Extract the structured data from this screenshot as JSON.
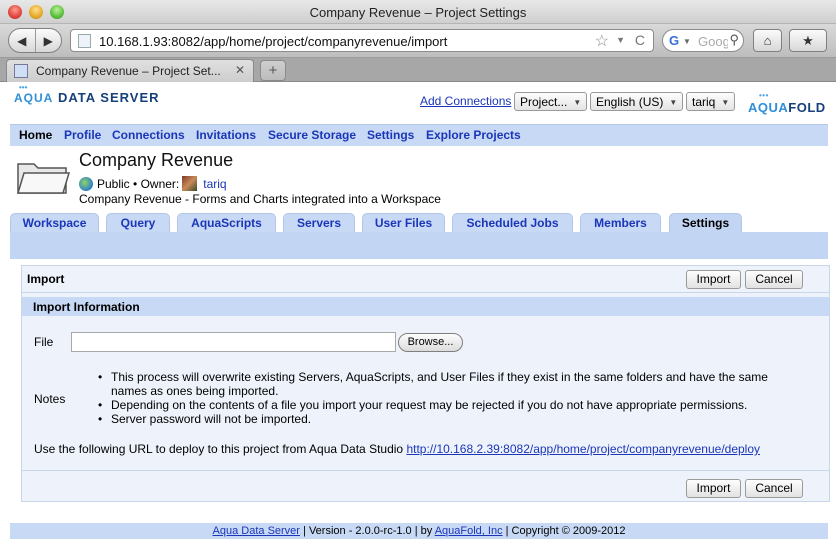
{
  "window": {
    "title": "Company Revenue – Project Settings"
  },
  "browser": {
    "url": "10.168.1.93:8082/app/home/project/companyrevenue/import",
    "search_placeholder": "Goog",
    "search_engine_icon": "G",
    "tab_title": "Company Revenue – Project Set...",
    "new_tab_symbol": "+",
    "back_icon": "◀",
    "forward_icon": "▶",
    "star_icon": "☆",
    "reload_icon": "C",
    "home_icon": "⌂",
    "addons_icon": "★"
  },
  "header": {
    "logo_left": {
      "prefix": "AQUA",
      "suffix": "DATA SERVER",
      "dots": "•••"
    },
    "add_connections": "Add Connections",
    "project_select": "Project...",
    "language_select": "English (US)",
    "user_select": "tariq",
    "logo_right": {
      "prefix": "AQUA",
      "suffix": "FOLD",
      "dots": "•••"
    }
  },
  "main_nav": [
    "Home",
    "Profile",
    "Connections",
    "Invitations",
    "Secure Storage",
    "Settings",
    "Explore Projects"
  ],
  "project": {
    "title": "Company Revenue",
    "visibility": "Public •",
    "owner_label": "Owner:",
    "owner": "tariq",
    "description": "Company Revenue - Forms and Charts integrated into a Workspace"
  },
  "project_tabs": [
    "Workspace",
    "Query",
    "AquaScripts",
    "Servers",
    "User Files",
    "Scheduled Jobs",
    "Members",
    "Settings"
  ],
  "import_panel": {
    "title": "Import",
    "import_button": "Import",
    "cancel_button": "Cancel",
    "section_title": "Import Information",
    "file_label": "File",
    "browse_button": "Browse...",
    "notes_label": "Notes",
    "notes": [
      "This process will overwrite existing Servers, AquaScripts, and User Files if they exist in the same folders and have the same names as ones being imported.",
      "Depending on the contents of a file you import your request may be rejected if you do not have appropriate permissions.",
      "Server password will not be imported."
    ],
    "deploy_text": "Use the following URL to deploy to this project from Aqua Data Studio",
    "deploy_url": "http://10.168.2.39:8082/app/home/project/companyrevenue/deploy"
  },
  "footer": {
    "product_link": "Aqua Data Server",
    "version": "| Version - 2.0.0-rc-1.0 | by",
    "company_link": "AquaFold, Inc",
    "copyright": "| Copyright © 2009-2012"
  },
  "colors": {
    "link": "#1b36b8",
    "nav_band": "#c7d9f4",
    "panel_bg": "#eef3fb"
  }
}
